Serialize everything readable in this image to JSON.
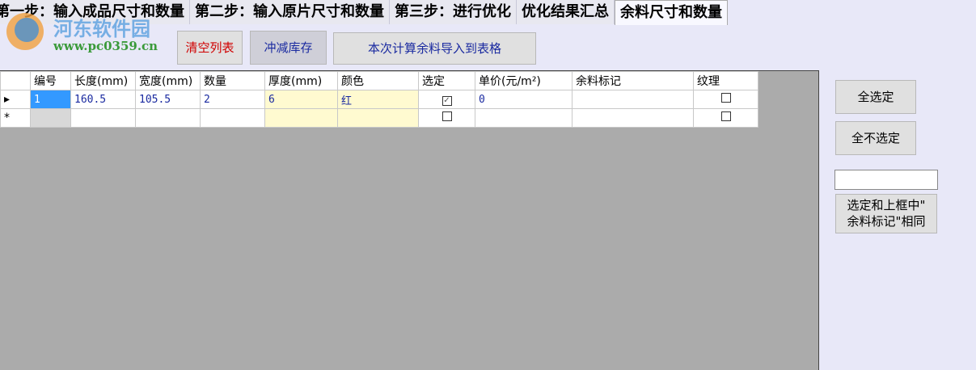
{
  "tabs": [
    "第一步：输入成品尺寸和数量",
    "第二步：输入原片尺寸和数量",
    "第三步：进行优化",
    "优化结果汇总",
    "余料尺寸和数量"
  ],
  "watermark": {
    "name": "河东软件园",
    "url": "www.pc0359.cn"
  },
  "toolbar": {
    "clear": "清空列表",
    "deduct": "冲减库存",
    "import": "本次计算余料导入到表格"
  },
  "table": {
    "columns": [
      "编号",
      "长度(mm)",
      "宽度(mm)",
      "数量",
      "厚度(mm)",
      "颜色",
      "选定",
      "单价(元/m²)",
      "余料标记",
      "纹理"
    ],
    "rows": [
      {
        "id": "1",
        "length": "160.5",
        "width": "105.5",
        "qty": "2",
        "thickness": "6",
        "color": "红",
        "selected": true,
        "price": "0",
        "mark": "",
        "grain": false
      }
    ],
    "new_row_marker": "*",
    "current_row_marker": "▸"
  },
  "side": {
    "select_all": "全选定",
    "select_none": "全不选定",
    "mark_input": "",
    "select_same_l1": "选定和上框中\"",
    "select_same_l2": "余料标记\"相同"
  }
}
